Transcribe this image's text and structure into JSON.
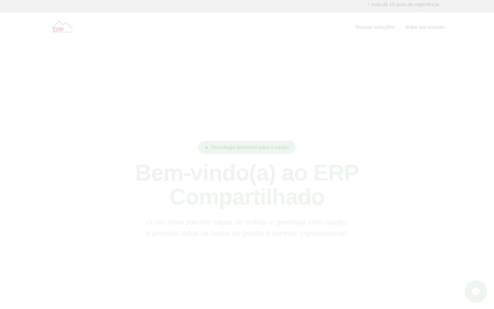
{
  "topbar": {
    "text": "+ mais de 15 anos de experiência"
  },
  "header": {
    "logo_text": "ERP",
    "nav": [
      {
        "label": "Nossas soluções"
      },
      {
        "label": "Entre em contato"
      }
    ]
  },
  "hero": {
    "badge": "Tecnologia favorável para o varejo",
    "title_prefix": "Bem-vindo(a) ao ",
    "title_accent": "ERP Compartilhado",
    "description": "O seu novo parceiro capaz de unificar e gerenciar com rapidez e precisão todos os dados de gestão e controle organizacional."
  },
  "colors": {
    "accent": "#eef6ef",
    "topbar_bg": "#f2f2f2",
    "logo": "#efc7cb"
  },
  "icons": {
    "chat": "chat-bubble-icon",
    "logo": "mountain-logo-icon"
  }
}
